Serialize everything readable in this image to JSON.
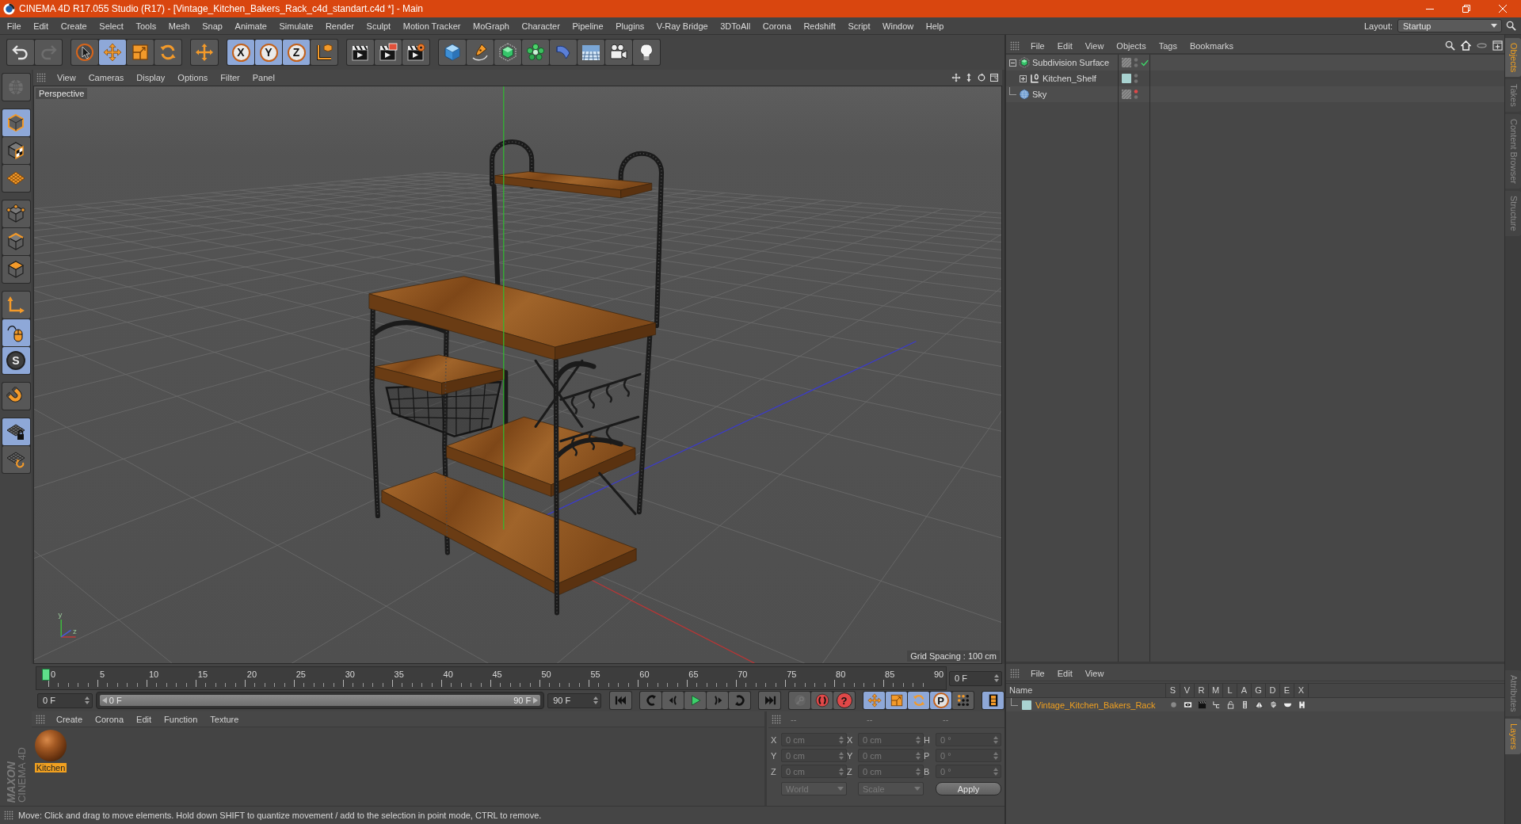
{
  "window": {
    "title": "CINEMA 4D R17.055 Studio (R17) - [Vintage_Kitchen_Bakers_Rack_c4d_standart.c4d *] - Main"
  },
  "menu_bar": {
    "items": [
      "File",
      "Edit",
      "Create",
      "Select",
      "Tools",
      "Mesh",
      "Snap",
      "Animate",
      "Simulate",
      "Render",
      "Sculpt",
      "Motion Tracker",
      "MoGraph",
      "Character",
      "Pipeline",
      "Plugins",
      "V-Ray Bridge",
      "3DToAll",
      "Corona",
      "Redshift",
      "Script",
      "Window",
      "Help"
    ],
    "layout_label": "Layout:",
    "layout_value": "Startup"
  },
  "toolbar": {
    "groups": [
      [
        {
          "kind": "undo",
          "selected": false,
          "disabled": false
        },
        {
          "kind": "redo",
          "selected": false,
          "disabled": true
        }
      ],
      [
        {
          "kind": "select",
          "selected": false,
          "disabled": false
        },
        {
          "kind": "move",
          "selected": true,
          "disabled": false
        },
        {
          "kind": "scale",
          "selected": false,
          "disabled": false
        },
        {
          "kind": "rotate",
          "selected": false,
          "disabled": false
        }
      ],
      [
        {
          "kind": "recent",
          "selected": false,
          "disabled": false
        }
      ],
      [
        {
          "kind": "axis_lock",
          "label": "X",
          "selected": true,
          "disabled": false
        },
        {
          "kind": "axis_lock",
          "label": "Y",
          "selected": true,
          "disabled": false
        },
        {
          "kind": "axis_lock",
          "label": "Z",
          "selected": true,
          "disabled": false
        },
        {
          "kind": "coordinate_system",
          "selected": false,
          "disabled": false
        }
      ],
      [
        {
          "kind": "render_view",
          "selected": false,
          "disabled": false
        },
        {
          "kind": "render_picture",
          "selected": false,
          "disabled": false
        },
        {
          "kind": "render_settings",
          "selected": false,
          "disabled": false
        }
      ],
      [
        {
          "kind": "cube",
          "selected": false,
          "disabled": false
        },
        {
          "kind": "spline_pen",
          "selected": false,
          "disabled": false
        },
        {
          "kind": "subdivision",
          "selected": false,
          "disabled": false
        },
        {
          "kind": "cloner",
          "selected": false,
          "disabled": false
        },
        {
          "kind": "deformer",
          "selected": false,
          "disabled": false
        },
        {
          "kind": "scene",
          "selected": false,
          "disabled": false
        },
        {
          "kind": "camera",
          "selected": false,
          "disabled": false
        },
        {
          "kind": "light",
          "selected": false,
          "disabled": false
        }
      ]
    ]
  },
  "tools": {
    "groups": [
      [
        {
          "kind": "make_editable",
          "selected": false,
          "disabled": true
        }
      ],
      [
        {
          "kind": "model",
          "selected": true,
          "disabled": false
        },
        {
          "kind": "texture",
          "selected": false,
          "disabled": false
        },
        {
          "kind": "workplane",
          "selected": false,
          "disabled": false
        }
      ],
      [
        {
          "kind": "points",
          "selected": false,
          "disabled": false
        },
        {
          "kind": "edges",
          "selected": false,
          "disabled": false
        },
        {
          "kind": "polygons",
          "selected": false,
          "disabled": false
        }
      ],
      [
        {
          "kind": "axis",
          "selected": false,
          "disabled": false
        },
        {
          "kind": "tweak",
          "selected": true,
          "disabled": false
        },
        {
          "kind": "solo",
          "label": "S",
          "selected": true,
          "disabled": false
        }
      ],
      [
        {
          "kind": "snap",
          "selected": false,
          "disabled": false
        }
      ],
      [
        {
          "kind": "workplane_lock",
          "selected": true,
          "disabled": false
        },
        {
          "kind": "workplane_align",
          "selected": false,
          "disabled": false
        }
      ]
    ]
  },
  "viewport": {
    "menu": [
      "View",
      "Cameras",
      "Display",
      "Options",
      "Filter",
      "Panel"
    ],
    "camera": "Perspective",
    "grid_spacing": "Grid Spacing : 100 cm",
    "gizmo_labels": [
      "y",
      "z"
    ]
  },
  "timeline": {
    "ruler_labels": [
      "0",
      "5",
      "10",
      "15",
      "20",
      "25",
      "30",
      "35",
      "40",
      "45",
      "50",
      "55",
      "60",
      "65",
      "70",
      "75",
      "80",
      "85",
      "90"
    ],
    "playhead": {
      "level": 0
    },
    "current_frame": "0 F",
    "start_field": "0 F",
    "range": {
      "start": "0 F",
      "end": "90 F",
      "level": 1
    },
    "end_field": "90 F",
    "transport_groups": [
      [
        {
          "kind": "skip_start"
        }
      ],
      [
        {
          "kind": "back_arc"
        },
        {
          "kind": "step_back"
        },
        {
          "kind": "play"
        },
        {
          "kind": "step_forward"
        },
        {
          "kind": "forward_arc"
        }
      ],
      [
        {
          "kind": "skip_end"
        }
      ]
    ],
    "key_buttons": [
      {
        "kind": "key",
        "disabled": true
      },
      {
        "kind": "record",
        "disabled": false
      },
      {
        "kind": "help",
        "label": "?",
        "disabled": false
      }
    ],
    "mode_buttons": [
      {
        "kind": "move",
        "selected": true
      },
      {
        "kind": "scale",
        "selected": true
      },
      {
        "kind": "rotate",
        "selected": true
      },
      {
        "kind": "param",
        "label": "P",
        "selected": true
      },
      {
        "kind": "point_level",
        "selected": false
      }
    ],
    "timeline_button": {
      "kind": "timeline",
      "selected": true
    }
  },
  "material_manager": {
    "menu": [
      "Create",
      "Corona",
      "Edit",
      "Function",
      "Texture"
    ],
    "materials": [
      {
        "name": "Kitchen",
        "selected": true
      }
    ]
  },
  "coordinates": {
    "disabled": true,
    "headers": [
      "--",
      "--",
      "--"
    ],
    "rows": [
      {
        "labels": [
          "X",
          "X",
          "H"
        ],
        "values": [
          "0 cm",
          "0 cm",
          "0 °"
        ]
      },
      {
        "labels": [
          "Y",
          "Y",
          "P"
        ],
        "values": [
          "0 cm",
          "0 cm",
          "0 °"
        ]
      },
      {
        "labels": [
          "Z",
          "Z",
          "B"
        ],
        "values": [
          "0 cm",
          "0 cm",
          "0 °"
        ]
      }
    ],
    "dropdowns": [
      "World",
      "Scale"
    ],
    "apply": "Apply"
  },
  "status_bar": {
    "text": "Move: Click and drag to move elements. Hold down SHIFT to quantize movement / add to the selection in point mode, CTRL to remove."
  },
  "object_manager": {
    "menu": [
      "File",
      "Edit",
      "View",
      "Objects",
      "Tags",
      "Bookmarks"
    ],
    "objects": [
      {
        "name": "Subdivision Surface",
        "kind": "subdivision",
        "expanded": true,
        "visible_in_editor": true,
        "enabled": true,
        "children": [
          {
            "name": "Kitchen_Shelf",
            "kind": "null",
            "expanded": false,
            "color": "#a9d3d1",
            "visible_in_editor": true,
            "enabled": false
          }
        ]
      },
      {
        "name": "Sky",
        "kind": "sky",
        "visible_in_editor": false,
        "enabled": false
      }
    ]
  },
  "layer_manager": {
    "menu": [
      "File",
      "Edit",
      "View"
    ],
    "columns": [
      "Name",
      "S",
      "V",
      "R",
      "M",
      "L",
      "A",
      "G",
      "D",
      "E",
      "X"
    ],
    "rows": [
      {
        "name": "Vintage_Kitchen_Bakers_Rack",
        "color": "#a9d3d1"
      }
    ]
  },
  "side_tabs": {
    "top": [
      {
        "label": "Objects",
        "selected": true
      },
      {
        "label": "Takes",
        "selected": false
      },
      {
        "label": "Content Browser",
        "selected": false
      },
      {
        "label": "Structure",
        "selected": false
      }
    ],
    "bottom": [
      {
        "label": "Attributes",
        "selected": false
      },
      {
        "label": "Layers",
        "selected": true
      }
    ]
  },
  "logo": {
    "brand": "MAXON",
    "product": "CINEMA 4D"
  }
}
